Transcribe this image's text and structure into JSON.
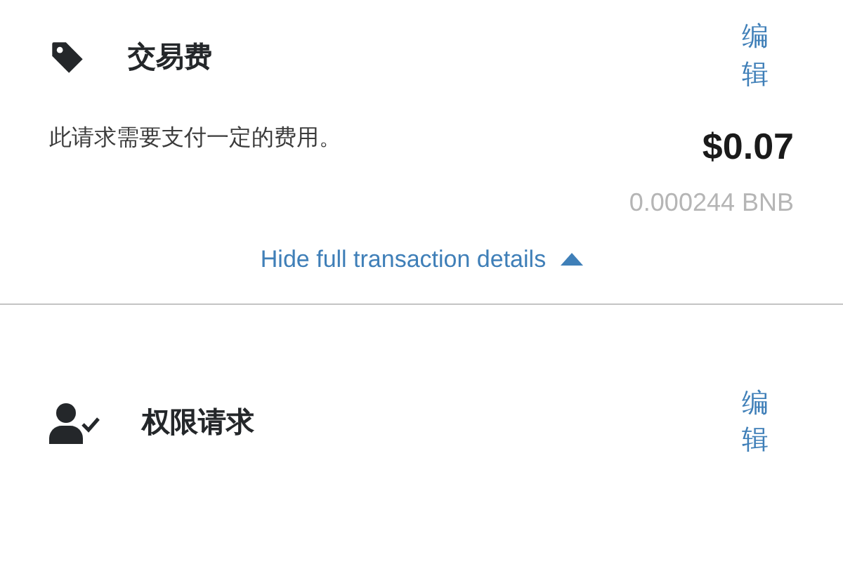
{
  "sections": [
    {
      "kind": "fee",
      "title": "交易费",
      "edit": "编辑",
      "description": "此请求需要支付一定的费用。",
      "amount": "$0.07",
      "amount_native": "0.000244 BNB",
      "details_toggle": {
        "label": "Hide full transaction details",
        "expanded": true
      }
    },
    {
      "kind": "permission",
      "title": "权限请求",
      "edit": "编辑"
    }
  ]
}
